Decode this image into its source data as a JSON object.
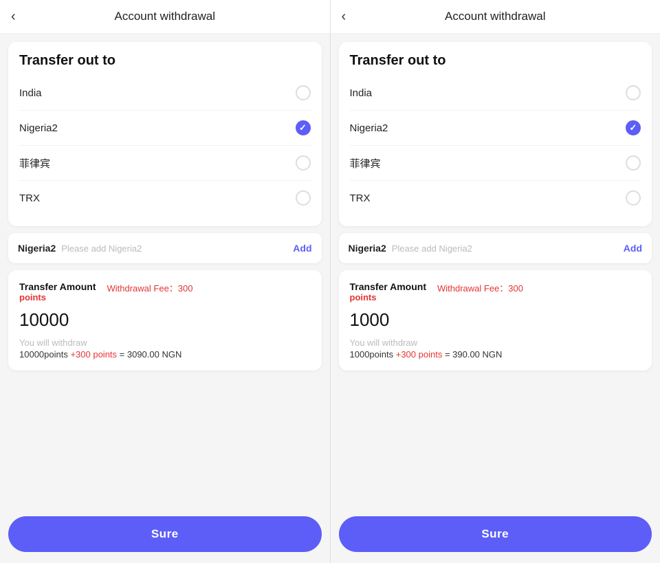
{
  "screens": [
    {
      "header": {
        "back_label": "‹",
        "title": "Account withdrawal"
      },
      "transfer_section": {
        "title": "Transfer out to",
        "countries": [
          {
            "name": "India",
            "checked": false
          },
          {
            "name": "Nigeria2",
            "checked": true
          },
          {
            "name": "菲律宾",
            "checked": false
          },
          {
            "name": "TRX",
            "checked": false
          }
        ]
      },
      "nigeria_row": {
        "label": "Nigeria2",
        "placeholder": "Please add Nigeria2",
        "add_label": "Add"
      },
      "amount_section": {
        "label_top": "Transfer Amount",
        "label_sub": "points",
        "fee_text": "Withdrawal Fee：300",
        "amount_value": "10000",
        "withdraw_info": "You will withdraw",
        "calc_main": "10000points ",
        "calc_bonus": "+300 points",
        "calc_result": " = 3090.00 NGN"
      },
      "sure_button": "Sure"
    },
    {
      "header": {
        "back_label": "‹",
        "title": "Account withdrawal"
      },
      "transfer_section": {
        "title": "Transfer out to",
        "countries": [
          {
            "name": "India",
            "checked": false
          },
          {
            "name": "Nigeria2",
            "checked": true
          },
          {
            "name": "菲律宾",
            "checked": false
          },
          {
            "name": "TRX",
            "checked": false
          }
        ]
      },
      "nigeria_row": {
        "label": "Nigeria2",
        "placeholder": "Please add Nigeria2",
        "add_label": "Add"
      },
      "amount_section": {
        "label_top": "Transfer Amount",
        "label_sub": "points",
        "fee_text": "Withdrawal Fee：300",
        "amount_value": "1000",
        "withdraw_info": "You will withdraw",
        "calc_main": "1000points ",
        "calc_bonus": "+300 points",
        "calc_result": " = 390.00 NGN"
      },
      "sure_button": "Sure"
    }
  ]
}
